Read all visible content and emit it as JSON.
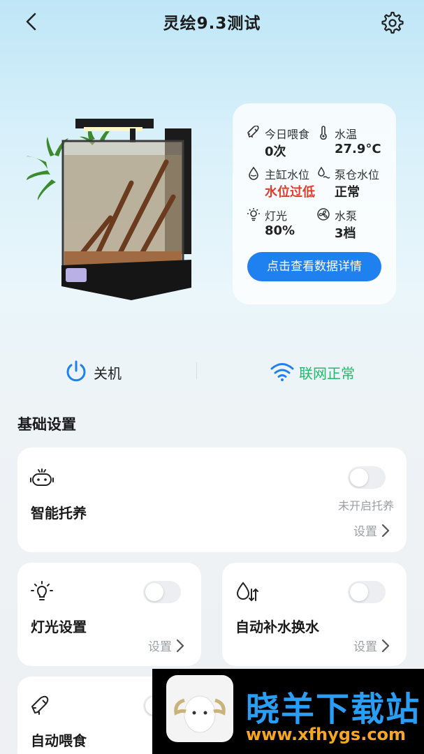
{
  "header": {
    "title": "灵绘9.3测试"
  },
  "stats": [
    {
      "label": "今日喂食",
      "value": "0次",
      "icon": "rocket-icon"
    },
    {
      "label": "水温",
      "value": "27.9°C",
      "icon": "thermometer-icon"
    },
    {
      "label": "主缸水位",
      "value": "水位过低",
      "icon": "water-drop-icon"
    },
    {
      "label": "泵仓水位",
      "value": "正常",
      "icon": "water-level-icon"
    },
    {
      "label": "灯光",
      "value": "80%",
      "icon": "light-icon"
    },
    {
      "label": "水泵",
      "value": "3档",
      "icon": "fan-icon"
    }
  ],
  "detail_button": "点击查看数据详情",
  "power": {
    "label": "关机"
  },
  "network": {
    "label": "联网正常"
  },
  "section_title": "基础设置",
  "tiles": {
    "smart": {
      "title": "智能托养",
      "status": "未开启托养",
      "link": "设置",
      "enabled": false
    },
    "light": {
      "title": "灯光设置",
      "link": "设置",
      "enabled": false
    },
    "water": {
      "title": "自动补水换水",
      "link": "设置",
      "enabled": false
    },
    "feed": {
      "title": "自动喂食",
      "enabled": false
    }
  },
  "watermark": {
    "name": "晓羊下载站",
    "url": "www.xfhygs.com"
  },
  "colors": {
    "accent": "#1f80f0",
    "alert": "#e23b2e",
    "online": "#1fba6a"
  }
}
